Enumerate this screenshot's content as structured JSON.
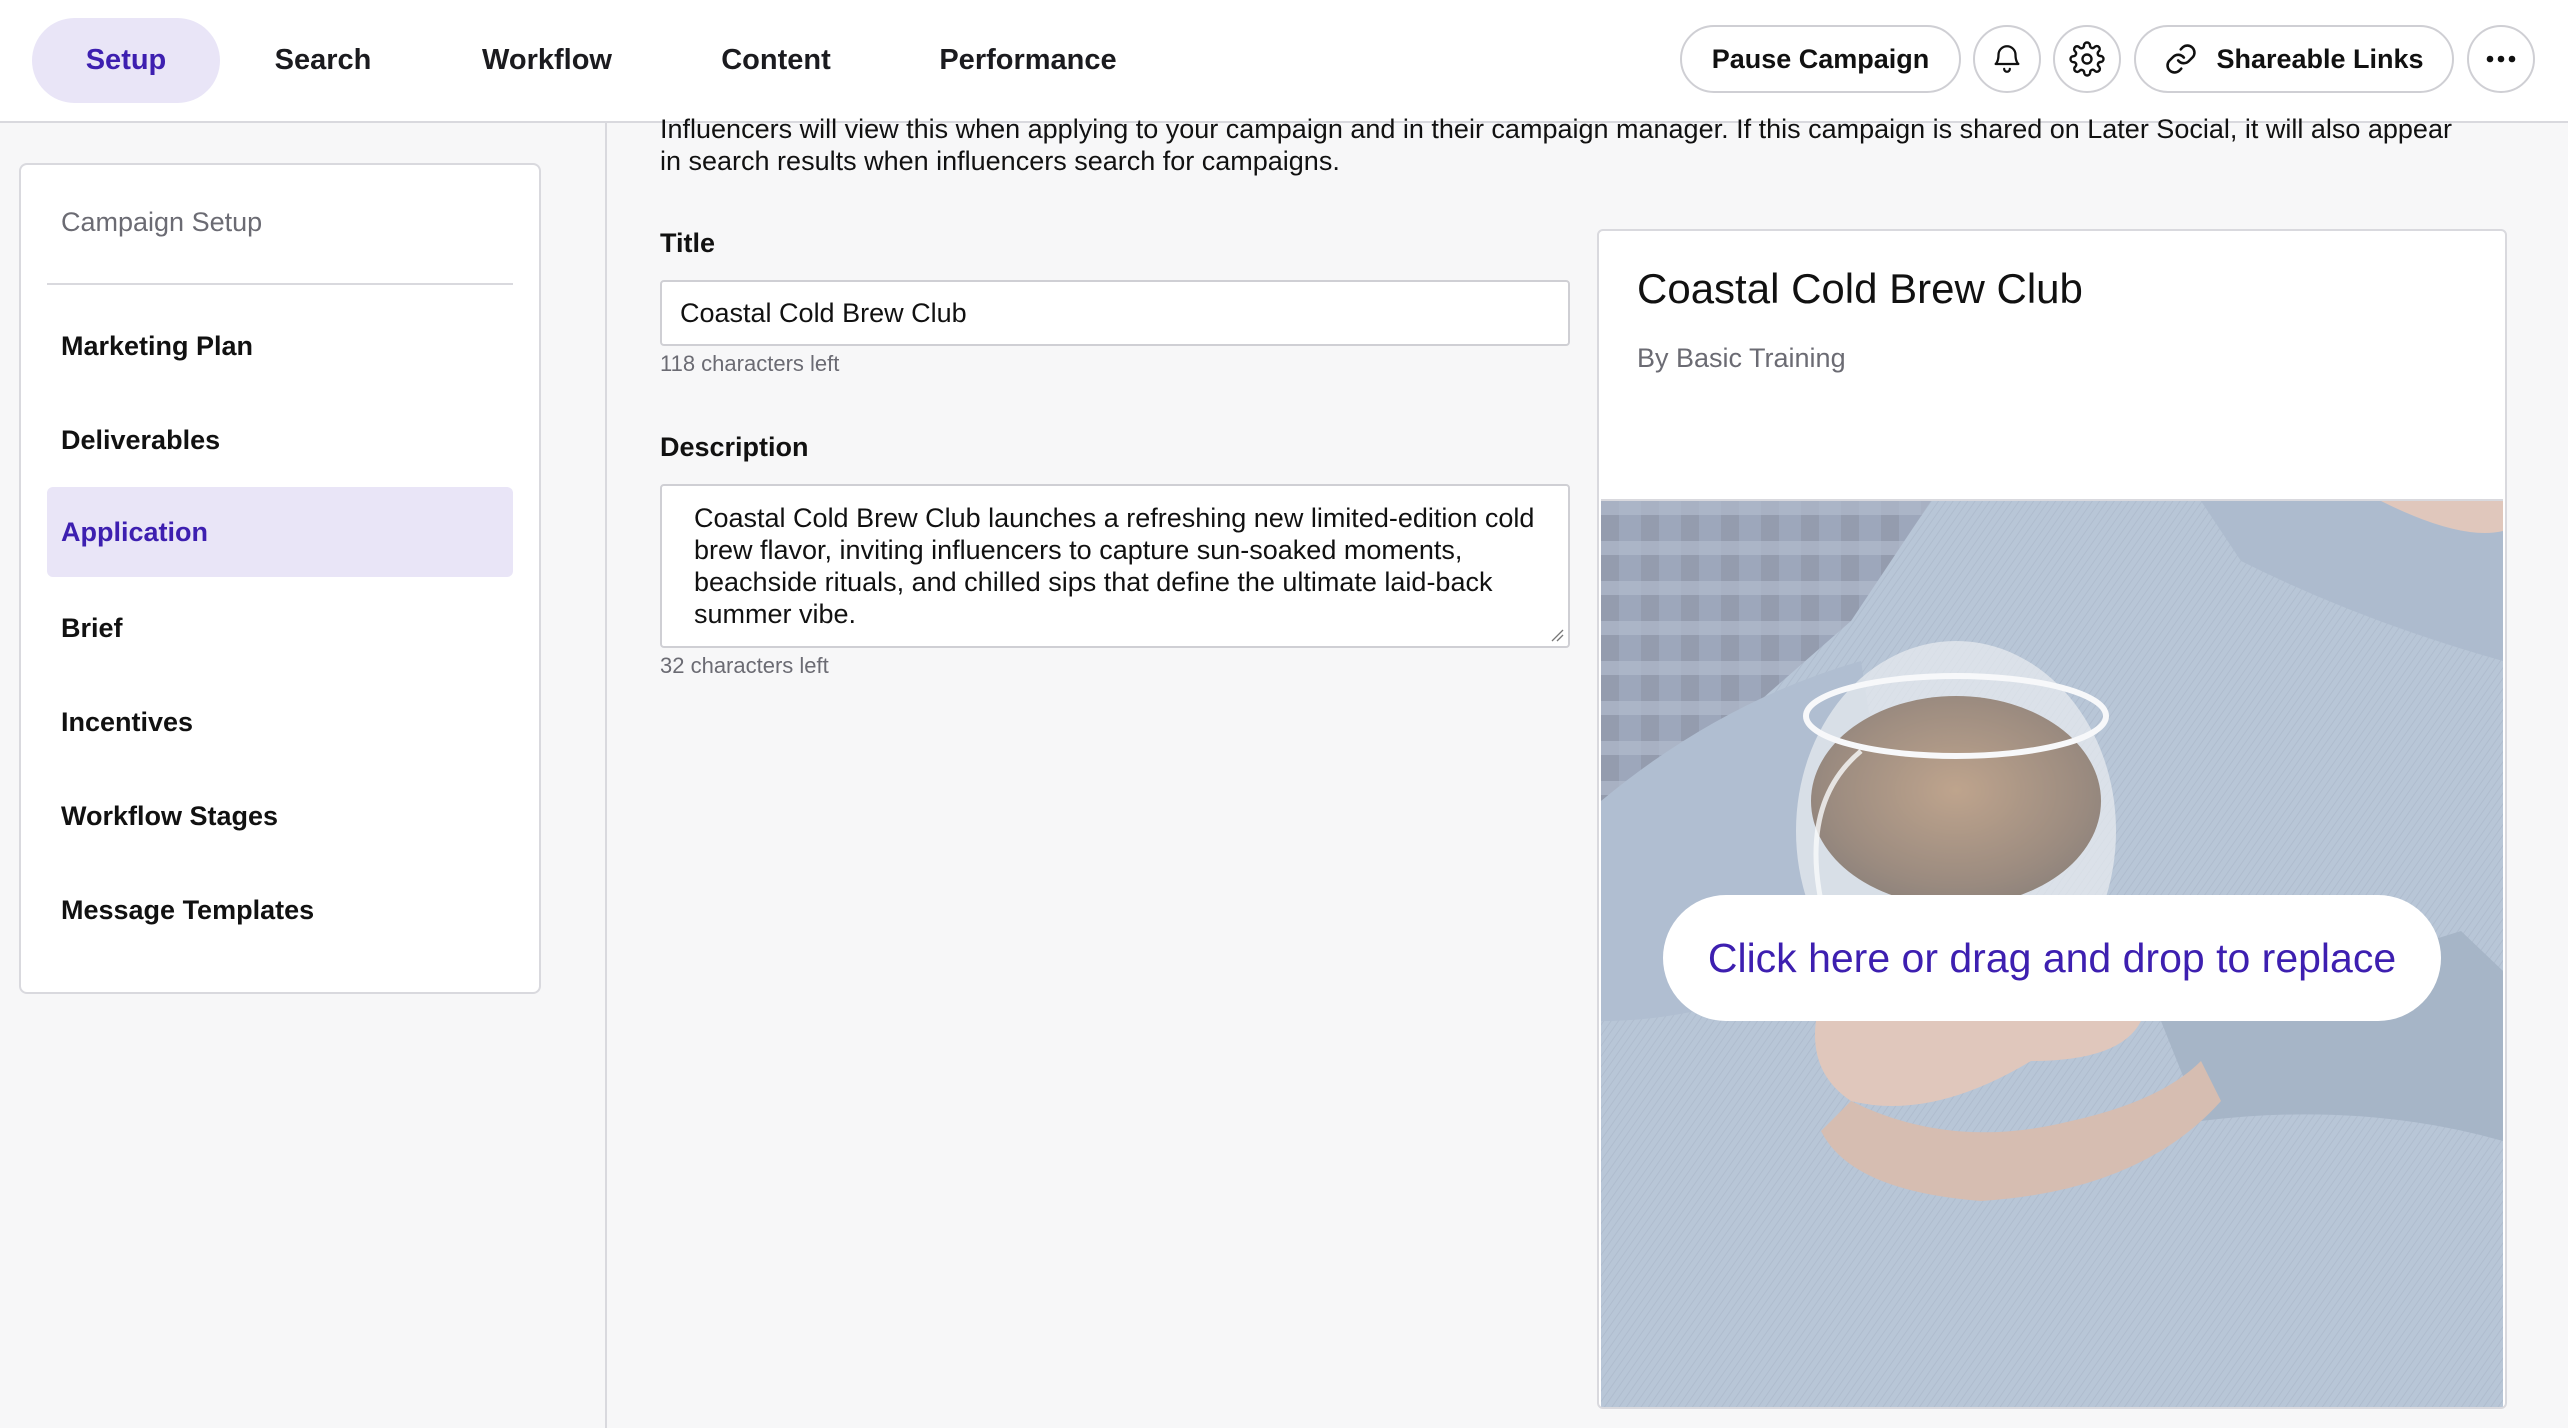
{
  "nav": {
    "tabs": [
      {
        "label": "Setup"
      },
      {
        "label": "Search"
      },
      {
        "label": "Workflow"
      },
      {
        "label": "Content"
      },
      {
        "label": "Performance"
      }
    ],
    "pause_label": "Pause Campaign",
    "shareable_label": "Shareable Links"
  },
  "sidebar": {
    "heading": "Campaign Setup",
    "items": [
      {
        "label": "Marketing Plan"
      },
      {
        "label": "Deliverables"
      },
      {
        "label": "Application"
      },
      {
        "label": "Brief"
      },
      {
        "label": "Incentives"
      },
      {
        "label": "Workflow Stages"
      },
      {
        "label": "Message Templates"
      }
    ],
    "active_item": "Application"
  },
  "main": {
    "intro_line1": "Influencers will view this when applying to your campaign and in their campaign manager. If this campaign is shared on Later Social, it will also appear",
    "intro_line2": "in search results when influencers search for campaigns.",
    "title_label": "Title",
    "title_value": "Coastal Cold Brew Club",
    "title_hint": "118 characters left",
    "description_label": "Description",
    "description_value": "Coastal Cold Brew Club launches a refreshing new limited-edition cold brew flavor, inviting influencers to capture sun-soaked moments, beachside rituals, and chilled sips that define the ultimate laid-back summer vibe.",
    "description_hint": "32 characters left"
  },
  "preview": {
    "title": "Coastal Cold Brew Club",
    "byline": "By Basic Training",
    "replace_label": "Click here or drag and drop to replace"
  },
  "colors": {
    "accent": "#3d1fb0",
    "accent_bg": "#e9e5f7",
    "border": "#d9d9de",
    "denim": "#7d95b3"
  }
}
